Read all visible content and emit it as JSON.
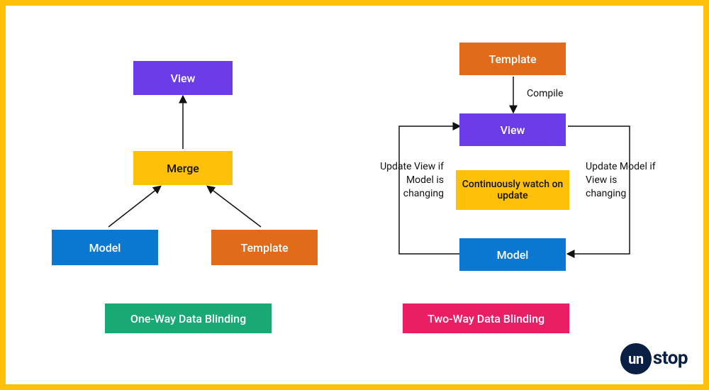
{
  "left": {
    "title": "One-Way Data Blinding",
    "view": "View",
    "merge": "Merge",
    "model": "Model",
    "template": "Template",
    "colors": {
      "view": "#6C3CE9",
      "merge": "#FFC107",
      "model": "#0A78D1",
      "template": "#E06C1B",
      "title_bg": "#19A974"
    }
  },
  "right": {
    "title": "Two-Way Data Blinding",
    "template": "Template",
    "view": "View",
    "watch": "Continuously watch on update",
    "model": "Model",
    "compile": "Compile",
    "update_view": "Update View if Model is changing",
    "update_model": "Update Model if View is changing",
    "colors": {
      "template": "#E06C1B",
      "view": "#6C3CE9",
      "watch": "#FFC107",
      "model": "#0A78D1",
      "title_bg": "#E91E63"
    }
  },
  "brand": {
    "prefix": "un",
    "suffix": "stop"
  }
}
